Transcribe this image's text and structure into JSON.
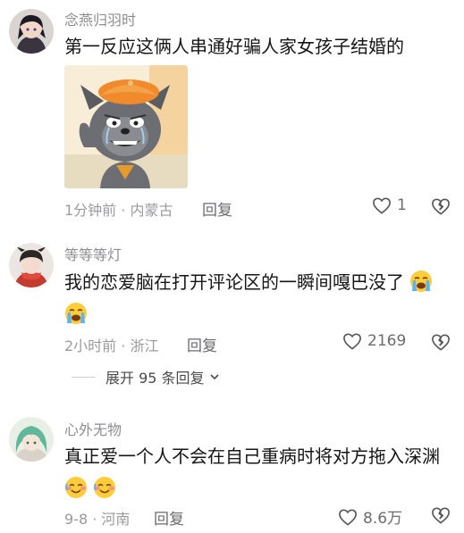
{
  "comments": [
    {
      "username": "念燕归羽时",
      "text": "第一反应这俩人串通好骗人家女孩子结婚的",
      "time_location": "1分钟前 · 内蒙古",
      "reply_label": "回复",
      "like_count": "1",
      "sticker": "grey-wolf-crying-sticker"
    },
    {
      "username": "等等等灯",
      "text_line1": "我的恋爱脑在打开评论区的一瞬间嘎巴没了",
      "emoji": "loudly-crying-emoji",
      "time_location": "2小时前 · 浙江",
      "reply_label": "回复",
      "like_count": "2169"
    },
    {
      "username": "心外无物",
      "text": "真正爱一个人不会在自己重病时将对方拖入深渊",
      "emoji": "tearful-smile-emoji",
      "time_location": "9-8 · 河南",
      "reply_label": "回复",
      "like_count": "8.6万"
    }
  ],
  "expand_replies": {
    "label": "展开 95 条回复"
  },
  "colors": {
    "text": "#161616",
    "meta": "#9a9a9f",
    "username": "#8d8d92"
  }
}
